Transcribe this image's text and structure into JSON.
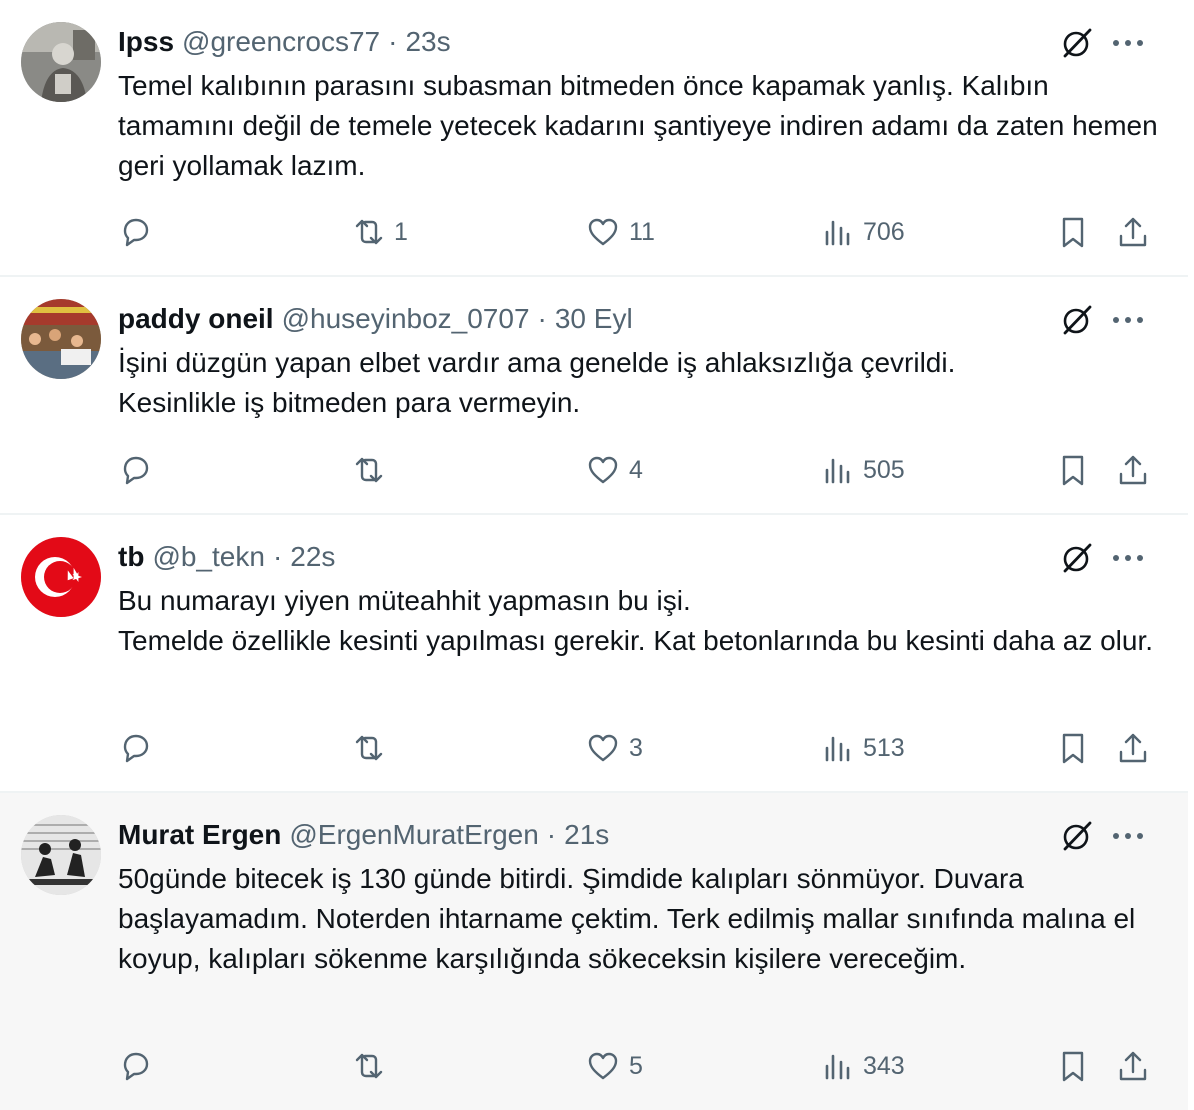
{
  "tweets": [
    {
      "name": "Ipss",
      "handle": "@greencrocs77",
      "time": "23s",
      "text": "Temel kalıbının parasını subasman bitmeden önce kapamak yanlış. Kalıbın tamamını değil de temele yetecek kadarını şantiyeye indiren adamı da zaten hemen geri yollamak lazım.",
      "replies": "",
      "retweets": "1",
      "likes": "11",
      "views": "706",
      "avatar": "elderly-man-photo"
    },
    {
      "name": "paddy oneil",
      "handle": "@huseyinboz_0707",
      "time": "30 Eyl",
      "text": "İşini düzgün yapan elbet vardır ama genelde iş ahlaksızlığa çevrildi.\nKesinlikle iş bitmeden para vermeyin.",
      "replies": "",
      "retweets": "",
      "likes": "4",
      "views": "505",
      "avatar": "crowd-photo"
    },
    {
      "name": "tb",
      "handle": "@b_tekn",
      "time": "22s",
      "text": "Bu numarayı yiyen müteahhit yapmasın bu işi.\nTemelde özellikle kesinti yapılması gerekir. Kat betonlarında bu kesinti daha az olur.",
      "replies": "",
      "retweets": "",
      "likes": "3",
      "views": "513",
      "avatar": "turkish-flag"
    },
    {
      "name": "Murat Ergen",
      "handle": "@ErgenMuratErgen",
      "time": "21s",
      "text": "50günde bitecek iş 130 günde bitirdi. Şimdide kalıpları sönmüyor. Duvara başlayamadım. Noterden ihtarname çektim. Terk edilmiş mallar sınıfında malına el koyup, kalıpları sökenme karşılığında sökeceksin kişilere vereceğim.",
      "replies": "",
      "retweets": "",
      "likes": "5",
      "views": "343",
      "avatar": "bw-figures-photo"
    }
  ],
  "colors": {
    "text": "#0f1419",
    "secondary": "#536471",
    "divider": "#eff3f4",
    "highlight": "#f7f7f7",
    "flag_red": "#e30a17"
  },
  "icons": [
    "reply-icon",
    "retweet-icon",
    "like-icon",
    "views-icon",
    "bookmark-icon",
    "share-icon",
    "grok-icon",
    "more-icon"
  ]
}
